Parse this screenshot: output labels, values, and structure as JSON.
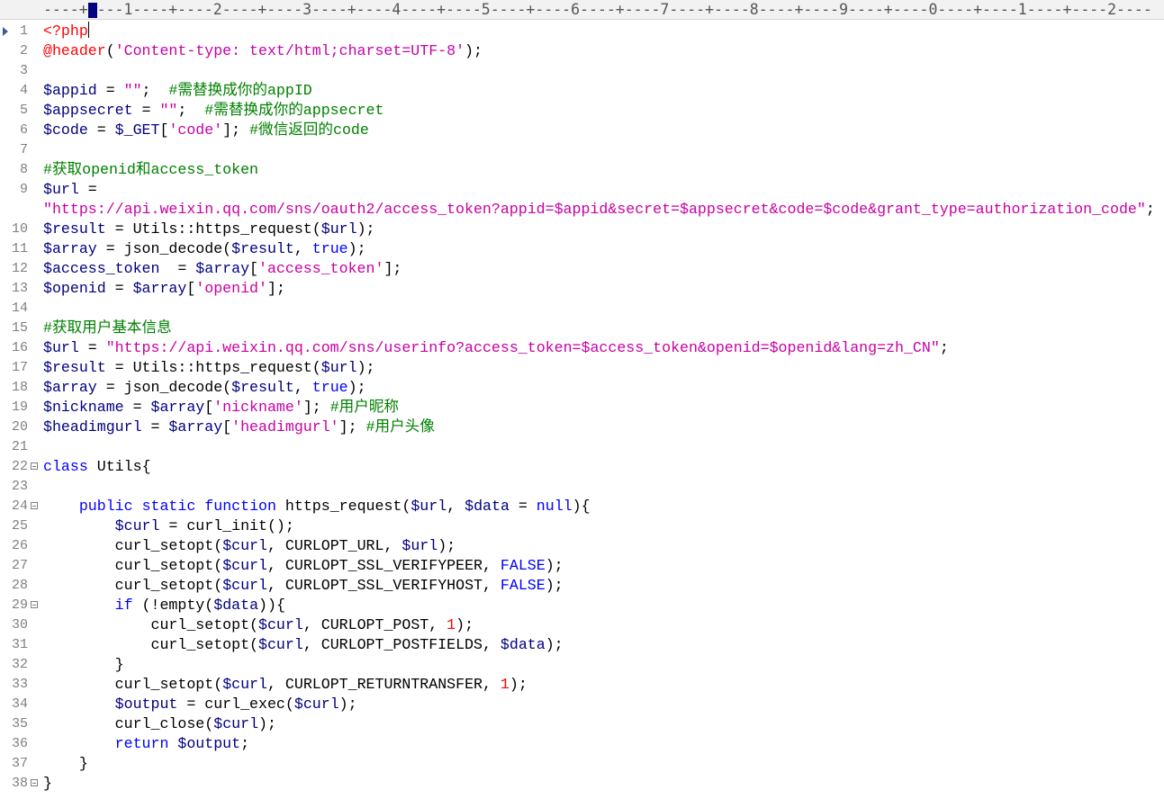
{
  "ruler": {
    "text": "----+----1----+----2----+----3----+----4----+----5----+----6----+----7----+----8----+----9----+----0----+----1----+----2----"
  },
  "colors": {
    "keyword": "#0000ff",
    "variable": "#000080",
    "string": "#c800a4",
    "comment": "#008000",
    "number": "#ff0000",
    "gutter_text": "#808080",
    "ruler_background": "#f2f2f2"
  },
  "lines": [
    {
      "num": "1",
      "bookmark": true,
      "fold": false,
      "tokens": [
        [
          "tag",
          "<?php"
        ]
      ],
      "cursor_after": true
    },
    {
      "num": "2",
      "fold": false,
      "tokens": [
        [
          "tag",
          "@header"
        ],
        [
          "op",
          "("
        ],
        [
          "str",
          "'Content-type: text/html;charset=UTF-8'"
        ],
        [
          "op",
          ");"
        ]
      ]
    },
    {
      "num": "3",
      "fold": false,
      "tokens": []
    },
    {
      "num": "4",
      "fold": false,
      "tokens": [
        [
          "var",
          "$appid"
        ],
        [
          "op",
          " = "
        ],
        [
          "str",
          "\"\""
        ],
        [
          "op",
          ";  "
        ],
        [
          "cmt",
          "#需替换成你的appID"
        ]
      ]
    },
    {
      "num": "5",
      "fold": false,
      "tokens": [
        [
          "var",
          "$appsecret"
        ],
        [
          "op",
          " = "
        ],
        [
          "str",
          "\"\""
        ],
        [
          "op",
          ";  "
        ],
        [
          "cmt",
          "#需替换成你的appsecret"
        ]
      ]
    },
    {
      "num": "6",
      "fold": false,
      "tokens": [
        [
          "var",
          "$code"
        ],
        [
          "op",
          " = "
        ],
        [
          "var",
          "$_GET"
        ],
        [
          "op",
          "["
        ],
        [
          "str",
          "'code'"
        ],
        [
          "op",
          "]; "
        ],
        [
          "cmt",
          "#微信返回的code"
        ]
      ]
    },
    {
      "num": "7",
      "fold": false,
      "tokens": []
    },
    {
      "num": "8",
      "fold": false,
      "tokens": [
        [
          "cmt",
          "#获取openid和access_token"
        ]
      ]
    },
    {
      "num": "9",
      "fold": false,
      "tokens": [
        [
          "var",
          "$url"
        ],
        [
          "op",
          " ="
        ]
      ]
    },
    {
      "num": "",
      "fold": false,
      "tokens": [
        [
          "str",
          "\"https://api.weixin.qq.com/sns/oauth2/access_token?appid=$appid&secret=$appsecret&code=$code&grant_type=authorization_code\""
        ],
        [
          "op",
          ";"
        ]
      ]
    },
    {
      "num": "10",
      "fold": false,
      "tokens": [
        [
          "var",
          "$result"
        ],
        [
          "op",
          " = "
        ],
        [
          "fn",
          "Utils::https_request"
        ],
        [
          "op",
          "("
        ],
        [
          "var",
          "$url"
        ],
        [
          "op",
          ");"
        ]
      ]
    },
    {
      "num": "11",
      "fold": false,
      "tokens": [
        [
          "var",
          "$array"
        ],
        [
          "op",
          " = "
        ],
        [
          "fn",
          "json_decode"
        ],
        [
          "op",
          "("
        ],
        [
          "var",
          "$result"
        ],
        [
          "op",
          ", "
        ],
        [
          "kw",
          "true"
        ],
        [
          "op",
          ");"
        ]
      ]
    },
    {
      "num": "12",
      "fold": false,
      "tokens": [
        [
          "var",
          "$access_token"
        ],
        [
          "op",
          "  = "
        ],
        [
          "var",
          "$array"
        ],
        [
          "op",
          "["
        ],
        [
          "str",
          "'access_token'"
        ],
        [
          "op",
          "];"
        ]
      ]
    },
    {
      "num": "13",
      "fold": false,
      "tokens": [
        [
          "var",
          "$openid"
        ],
        [
          "op",
          " = "
        ],
        [
          "var",
          "$array"
        ],
        [
          "op",
          "["
        ],
        [
          "str",
          "'openid'"
        ],
        [
          "op",
          "];"
        ]
      ]
    },
    {
      "num": "14",
      "fold": false,
      "tokens": []
    },
    {
      "num": "15",
      "fold": false,
      "tokens": [
        [
          "cmt",
          "#获取用户基本信息"
        ]
      ]
    },
    {
      "num": "16",
      "fold": false,
      "tokens": [
        [
          "var",
          "$url"
        ],
        [
          "op",
          " = "
        ],
        [
          "str",
          "\"https://api.weixin.qq.com/sns/userinfo?access_token=$access_token&openid=$openid&lang=zh_CN\""
        ],
        [
          "op",
          ";"
        ]
      ]
    },
    {
      "num": "17",
      "fold": false,
      "tokens": [
        [
          "var",
          "$result"
        ],
        [
          "op",
          " = "
        ],
        [
          "fn",
          "Utils::https_request"
        ],
        [
          "op",
          "("
        ],
        [
          "var",
          "$url"
        ],
        [
          "op",
          ");"
        ]
      ]
    },
    {
      "num": "18",
      "fold": false,
      "tokens": [
        [
          "var",
          "$array"
        ],
        [
          "op",
          " = "
        ],
        [
          "fn",
          "json_decode"
        ],
        [
          "op",
          "("
        ],
        [
          "var",
          "$result"
        ],
        [
          "op",
          ", "
        ],
        [
          "kw",
          "true"
        ],
        [
          "op",
          ");"
        ]
      ]
    },
    {
      "num": "19",
      "fold": false,
      "tokens": [
        [
          "var",
          "$nickname"
        ],
        [
          "op",
          " = "
        ],
        [
          "var",
          "$array"
        ],
        [
          "op",
          "["
        ],
        [
          "str",
          "'nickname'"
        ],
        [
          "op",
          "]; "
        ],
        [
          "cmt",
          "#用户昵称"
        ]
      ]
    },
    {
      "num": "20",
      "fold": false,
      "tokens": [
        [
          "var",
          "$headimgurl"
        ],
        [
          "op",
          " = "
        ],
        [
          "var",
          "$array"
        ],
        [
          "op",
          "["
        ],
        [
          "str",
          "'headimgurl'"
        ],
        [
          "op",
          "]; "
        ],
        [
          "cmt",
          "#用户头像"
        ]
      ]
    },
    {
      "num": "21",
      "fold": false,
      "tokens": []
    },
    {
      "num": "22",
      "fold": true,
      "tokens": [
        [
          "kw",
          "class"
        ],
        [
          "op",
          " "
        ],
        [
          "fn",
          "Utils"
        ],
        [
          "op",
          "{"
        ]
      ]
    },
    {
      "num": "23",
      "fold": false,
      "tokens": []
    },
    {
      "num": "24",
      "fold": true,
      "tokens": [
        [
          "op",
          "    "
        ],
        [
          "kw",
          "public"
        ],
        [
          "op",
          " "
        ],
        [
          "kw",
          "static"
        ],
        [
          "op",
          " "
        ],
        [
          "kw",
          "function"
        ],
        [
          "op",
          " "
        ],
        [
          "fn",
          "https_request"
        ],
        [
          "op",
          "("
        ],
        [
          "var",
          "$url"
        ],
        [
          "op",
          ", "
        ],
        [
          "var",
          "$data"
        ],
        [
          "op",
          " = "
        ],
        [
          "kw",
          "null"
        ],
        [
          "op",
          "){"
        ]
      ]
    },
    {
      "num": "25",
      "fold": false,
      "tokens": [
        [
          "op",
          "        "
        ],
        [
          "var",
          "$curl"
        ],
        [
          "op",
          " = "
        ],
        [
          "fn",
          "curl_init"
        ],
        [
          "op",
          "();"
        ]
      ]
    },
    {
      "num": "26",
      "fold": false,
      "tokens": [
        [
          "op",
          "        "
        ],
        [
          "fn",
          "curl_setopt"
        ],
        [
          "op",
          "("
        ],
        [
          "var",
          "$curl"
        ],
        [
          "op",
          ", "
        ],
        [
          "const",
          "CURLOPT_URL"
        ],
        [
          "op",
          ", "
        ],
        [
          "var",
          "$url"
        ],
        [
          "op",
          ");"
        ]
      ]
    },
    {
      "num": "27",
      "fold": false,
      "tokens": [
        [
          "op",
          "        "
        ],
        [
          "fn",
          "curl_setopt"
        ],
        [
          "op",
          "("
        ],
        [
          "var",
          "$curl"
        ],
        [
          "op",
          ", "
        ],
        [
          "const",
          "CURLOPT_SSL_VERIFYPEER"
        ],
        [
          "op",
          ", "
        ],
        [
          "kw",
          "FALSE"
        ],
        [
          "op",
          ");"
        ]
      ]
    },
    {
      "num": "28",
      "fold": false,
      "tokens": [
        [
          "op",
          "        "
        ],
        [
          "fn",
          "curl_setopt"
        ],
        [
          "op",
          "("
        ],
        [
          "var",
          "$curl"
        ],
        [
          "op",
          ", "
        ],
        [
          "const",
          "CURLOPT_SSL_VERIFYHOST"
        ],
        [
          "op",
          ", "
        ],
        [
          "kw",
          "FALSE"
        ],
        [
          "op",
          ");"
        ]
      ]
    },
    {
      "num": "29",
      "fold": true,
      "tokens": [
        [
          "op",
          "        "
        ],
        [
          "kw",
          "if"
        ],
        [
          "op",
          " (!"
        ],
        [
          "fn",
          "empty"
        ],
        [
          "op",
          "("
        ],
        [
          "var",
          "$data"
        ],
        [
          "op",
          ")){"
        ]
      ]
    },
    {
      "num": "30",
      "fold": false,
      "tokens": [
        [
          "op",
          "            "
        ],
        [
          "fn",
          "curl_setopt"
        ],
        [
          "op",
          "("
        ],
        [
          "var",
          "$curl"
        ],
        [
          "op",
          ", "
        ],
        [
          "const",
          "CURLOPT_POST"
        ],
        [
          "op",
          ", "
        ],
        [
          "num",
          "1"
        ],
        [
          "op",
          ");"
        ]
      ]
    },
    {
      "num": "31",
      "fold": false,
      "tokens": [
        [
          "op",
          "            "
        ],
        [
          "fn",
          "curl_setopt"
        ],
        [
          "op",
          "("
        ],
        [
          "var",
          "$curl"
        ],
        [
          "op",
          ", "
        ],
        [
          "const",
          "CURLOPT_POSTFIELDS"
        ],
        [
          "op",
          ", "
        ],
        [
          "var",
          "$data"
        ],
        [
          "op",
          ");"
        ]
      ]
    },
    {
      "num": "32",
      "fold": false,
      "tokens": [
        [
          "op",
          "        }"
        ]
      ]
    },
    {
      "num": "33",
      "fold": false,
      "tokens": [
        [
          "op",
          "        "
        ],
        [
          "fn",
          "curl_setopt"
        ],
        [
          "op",
          "("
        ],
        [
          "var",
          "$curl"
        ],
        [
          "op",
          ", "
        ],
        [
          "const",
          "CURLOPT_RETURNTRANSFER"
        ],
        [
          "op",
          ", "
        ],
        [
          "num",
          "1"
        ],
        [
          "op",
          ");"
        ]
      ]
    },
    {
      "num": "34",
      "fold": false,
      "tokens": [
        [
          "op",
          "        "
        ],
        [
          "var",
          "$output"
        ],
        [
          "op",
          " = "
        ],
        [
          "fn",
          "curl_exec"
        ],
        [
          "op",
          "("
        ],
        [
          "var",
          "$curl"
        ],
        [
          "op",
          ");"
        ]
      ]
    },
    {
      "num": "35",
      "fold": false,
      "tokens": [
        [
          "op",
          "        "
        ],
        [
          "fn",
          "curl_close"
        ],
        [
          "op",
          "("
        ],
        [
          "var",
          "$curl"
        ],
        [
          "op",
          ");"
        ]
      ]
    },
    {
      "num": "36",
      "fold": false,
      "tokens": [
        [
          "op",
          "        "
        ],
        [
          "kw",
          "return"
        ],
        [
          "op",
          " "
        ],
        [
          "var",
          "$output"
        ],
        [
          "op",
          ";"
        ]
      ]
    },
    {
      "num": "37",
      "fold": false,
      "tokens": [
        [
          "op",
          "    }"
        ]
      ]
    },
    {
      "num": "38",
      "fold": true,
      "tokens": [
        [
          "op",
          "}"
        ]
      ]
    }
  ]
}
